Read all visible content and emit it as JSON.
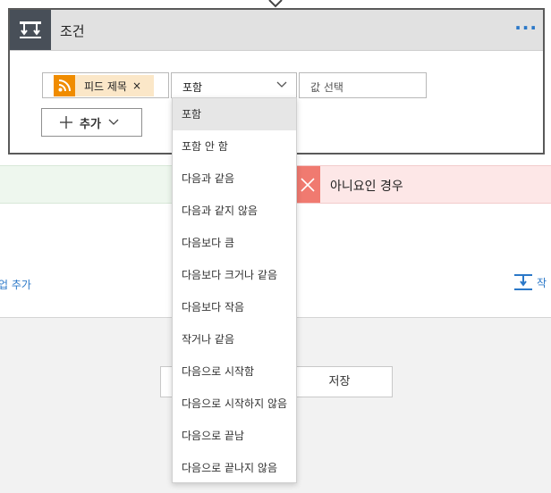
{
  "condition": {
    "title": "조건",
    "more_label": "···",
    "token": {
      "label": "피드 제목",
      "remove": "×",
      "icon": "rss-icon"
    },
    "operator": {
      "value": "포함"
    },
    "value_input": {
      "placeholder": "값 선택"
    },
    "add_button": {
      "label": "추가"
    }
  },
  "branches": {
    "no_label": "아니요인 경우"
  },
  "actions": {
    "left_add_action": "작업 추가",
    "right_action_label": "작"
  },
  "footer": {
    "save_label": "저장"
  },
  "dropdown": {
    "items": [
      "포함",
      "포함 안 함",
      "다음과 같음",
      "다음과 같지 않음",
      "다음보다 큼",
      "다음보다 크거나 같음",
      "다음보다 작음",
      "작거나 같음",
      "다음으로 시작함",
      "다음으로 시작하지 않음",
      "다음으로 끝남",
      "다음으로 끝나지 않음"
    ],
    "selected_index": 0
  },
  "colors": {
    "accent": "#2b78c8",
    "header_icon_bg": "#484f58",
    "rss_orange": "#f08c00",
    "token_bg": "#fbe7c8",
    "yes_bg": "#eef7ee",
    "no_bg": "#fde7e7",
    "no_icon_bg": "#f07a70"
  }
}
